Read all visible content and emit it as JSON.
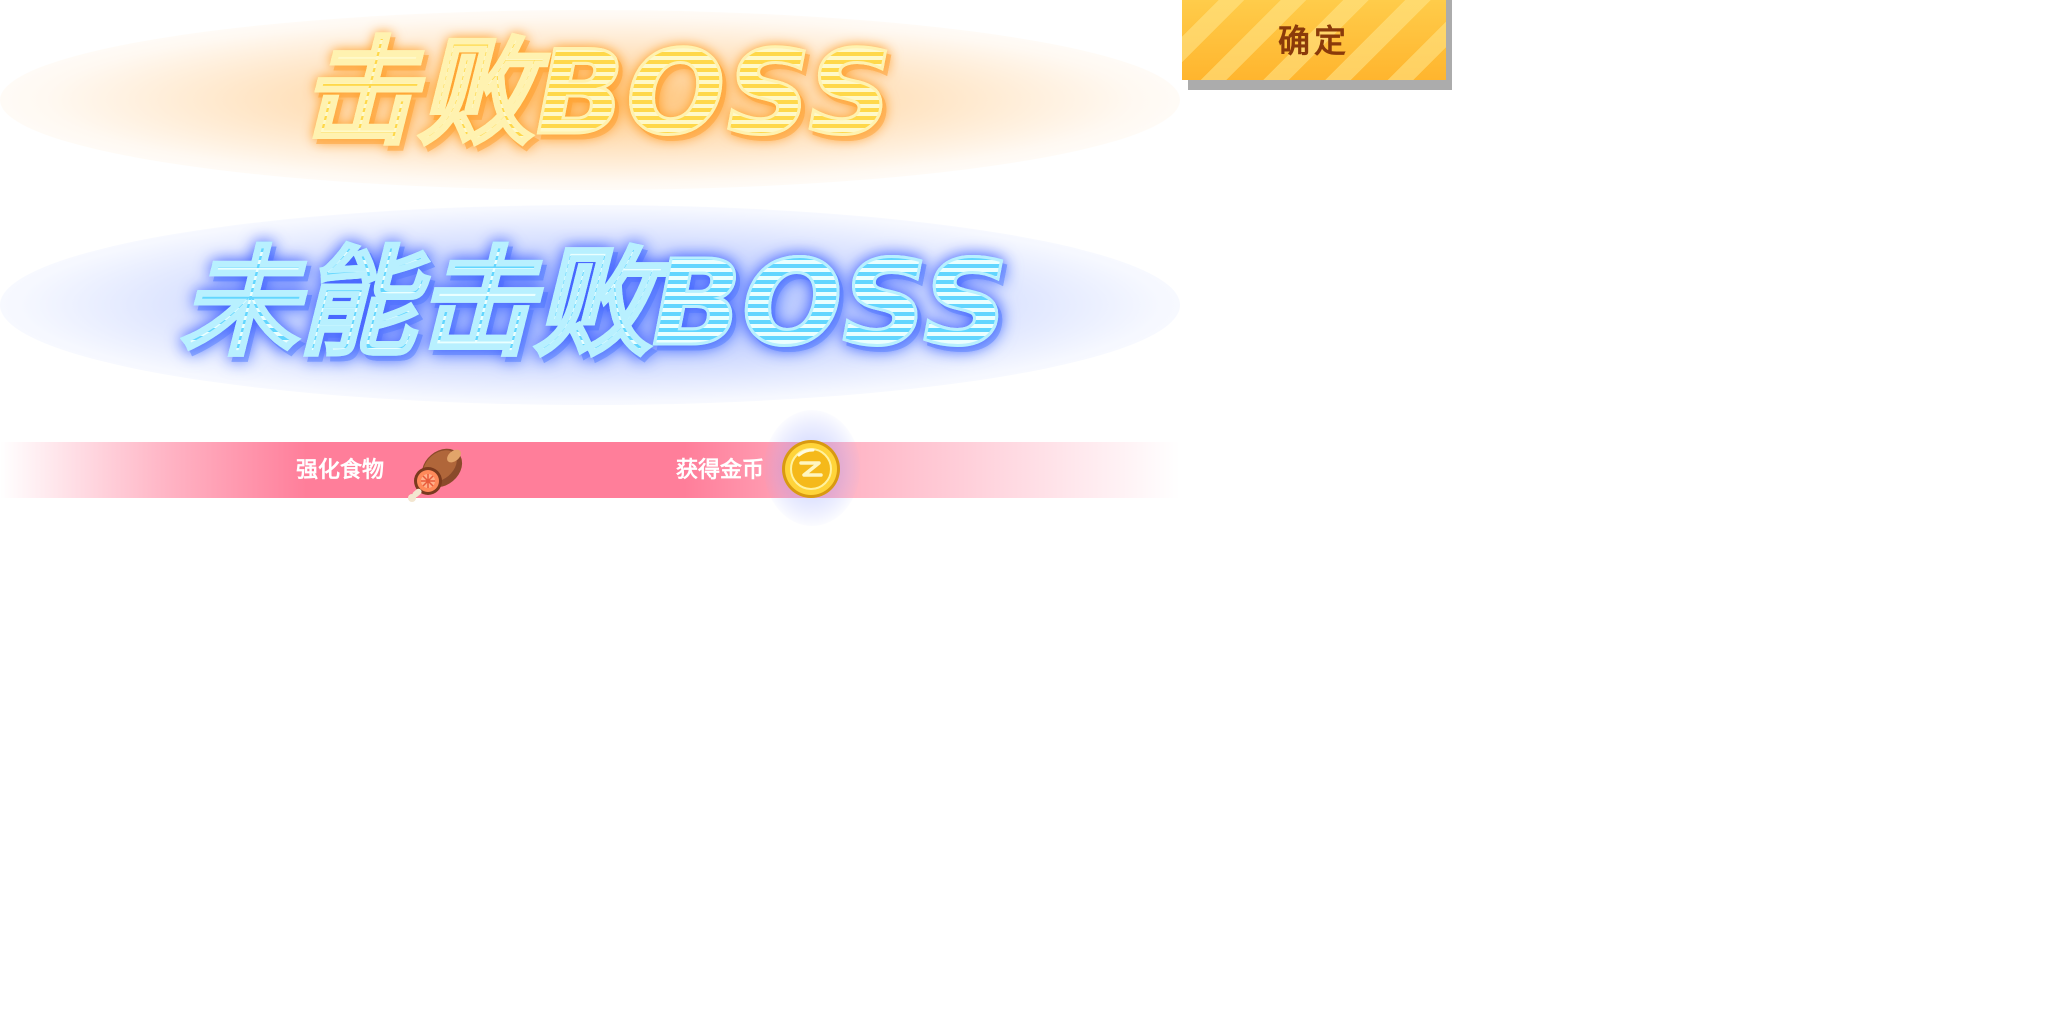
{
  "titles": {
    "victory": "击败BOSS",
    "defeat": "未能击败BOSS"
  },
  "rewards": {
    "food_label": "强化食物",
    "coin_label": "获得金币",
    "food_icon": "meat-icon",
    "coin_icon": "gold-coin-icon"
  },
  "buttons": {
    "confirm_label": "确定"
  },
  "colors": {
    "victory_accent": "#ffd84a",
    "defeat_accent": "#62d6ff",
    "reward_bar": "#ff7e9a",
    "button_fill": "#ffb52e",
    "button_text": "#8a3a0a"
  }
}
